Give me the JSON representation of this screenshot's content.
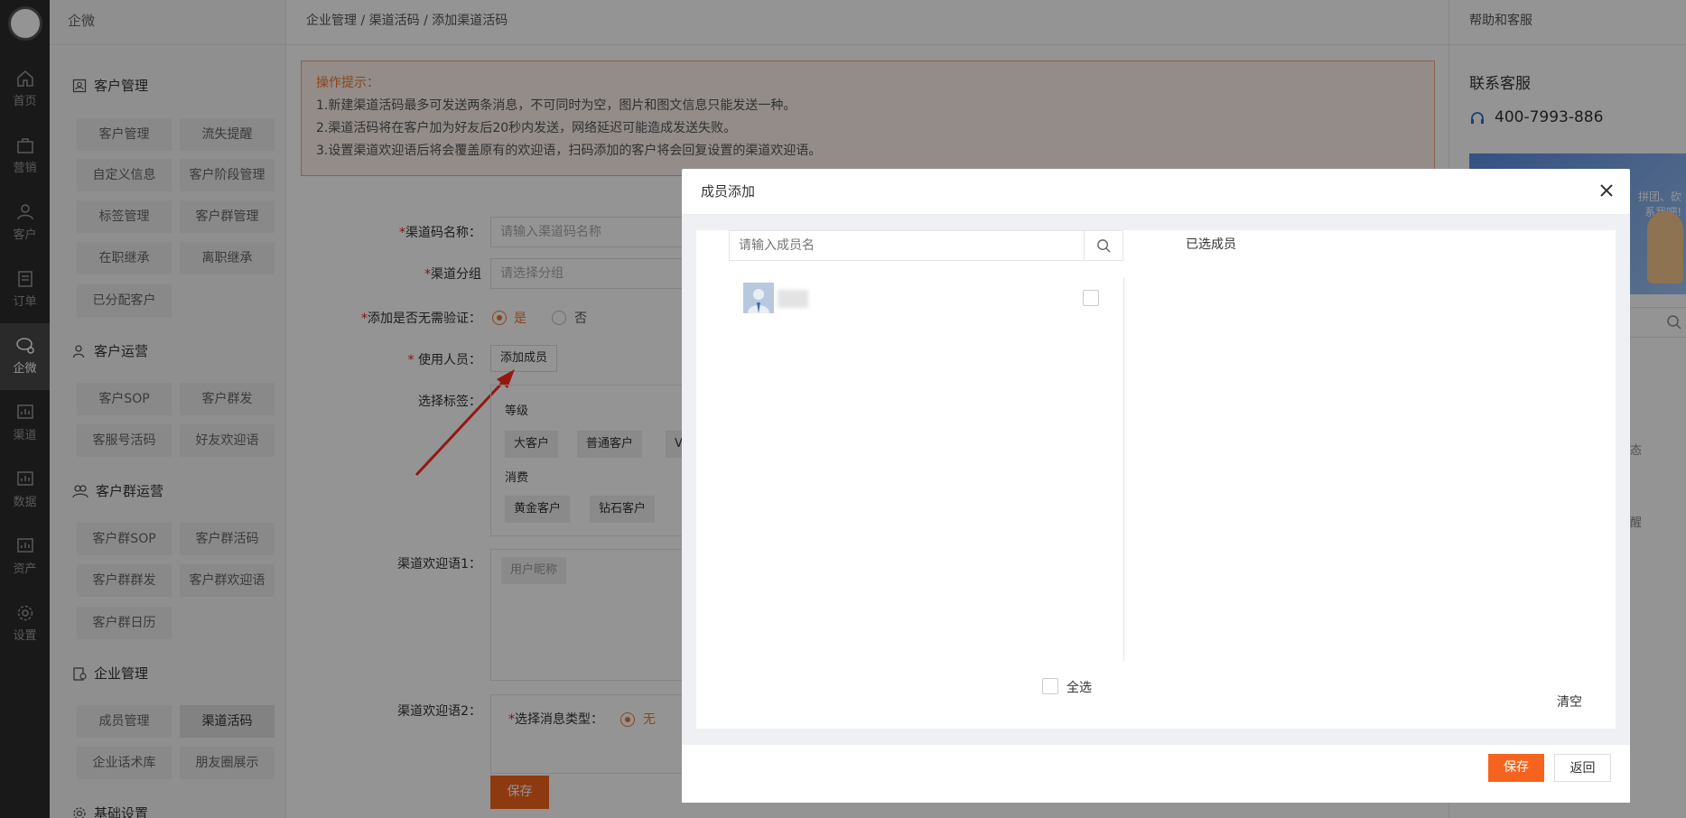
{
  "rail": {
    "items": [
      {
        "label": "首页",
        "icon": "home-icon"
      },
      {
        "label": "营销",
        "icon": "briefcase-icon"
      },
      {
        "label": "客户",
        "icon": "user-icon"
      },
      {
        "label": "订单",
        "icon": "document-icon"
      },
      {
        "label": "企微",
        "icon": "chat-icon"
      },
      {
        "label": "渠道",
        "icon": "chart-icon"
      },
      {
        "label": "数据",
        "icon": "chart-icon"
      },
      {
        "label": "资产",
        "icon": "chart-icon"
      },
      {
        "label": "设置",
        "icon": "gear-icon"
      }
    ],
    "active": "企微"
  },
  "sidebar": {
    "title": "企微",
    "groups": [
      {
        "label": "客户管理",
        "icon": "contact-icon",
        "items": [
          "客户管理",
          "流失提醒",
          "自定义信息",
          "客户阶段管理",
          "标签管理",
          "客户群管理",
          "在职继承",
          "离职继承",
          "已分配客户"
        ]
      },
      {
        "label": "客户运营",
        "icon": "person-icon",
        "items": [
          "客户SOP",
          "客户群发",
          "客服号活码",
          "好友欢迎语"
        ]
      },
      {
        "label": "客户群运营",
        "icon": "group-icon",
        "items": [
          "客户群SOP",
          "客户群活码",
          "客户群群发",
          "客户群欢迎语",
          "客户群日历"
        ]
      },
      {
        "label": "企业管理",
        "icon": "building-icon",
        "items": [
          "成员管理",
          "渠道活码",
          "企业话术库",
          "朋友圈展示"
        ]
      },
      {
        "label": "基础设置",
        "icon": "gear-icon",
        "items": []
      }
    ],
    "selected_item": "渠道活码"
  },
  "breadcrumb": "企业管理 / 渠道活码 / 添加渠道活码",
  "tips": {
    "title": "操作提示：",
    "lines": [
      "1.新建渠道活码最多可发送两条消息，不可同时为空，图片和图文信息只能发送一种。",
      "2.渠道活码将在客户加为好友后20秒内发送，网络延迟可能造成发送失败。",
      "3.设置渠道欢迎语后将会覆盖原有的欢迎语，扫码添加的客户将会回复设置的渠道欢迎语。"
    ]
  },
  "form": {
    "name_label": "渠道码名称：",
    "name_placeholder": "请输入渠道码名称",
    "group_label": "渠道分组",
    "group_placeholder": "请选择分组",
    "verify_label": "添加是否无需验证：",
    "verify_yes": "是",
    "verify_no": "否",
    "member_label": "使用人员：",
    "add_member_btn": "添加成员",
    "tag_label": "选择标签：",
    "tag_group1": "等级",
    "tags1": [
      "大客户",
      "普通客户",
      "V"
    ],
    "tag_group2": "消费",
    "tags2": [
      "黄金客户",
      "钻石客户"
    ],
    "welcome1_label": "渠道欢迎语1：",
    "nickname_tag": "用户昵称",
    "welcome2_label": "渠道欢迎语2：",
    "msg_type_label": "选择消息类型：",
    "msg_type_none": "无",
    "save_btn": "保存"
  },
  "help": {
    "title": "帮助和客服",
    "contact_label": "联系客服",
    "phone": "400-7993-886",
    "banner_text": "拼团、砍\n系我吧!",
    "side_text1": "态",
    "side_text2": "醒"
  },
  "modal": {
    "title": "成员添加",
    "search_placeholder": "请输入成员名",
    "selected_title": "已选成员",
    "select_all": "全选",
    "clear": "清空",
    "save": "保存",
    "back": "返回"
  },
  "colors": {
    "accent": "#f5641e",
    "rail_bg": "#2b2b2b",
    "tip_border": "#f0a583",
    "tip_bg": "#fdf2ec"
  }
}
